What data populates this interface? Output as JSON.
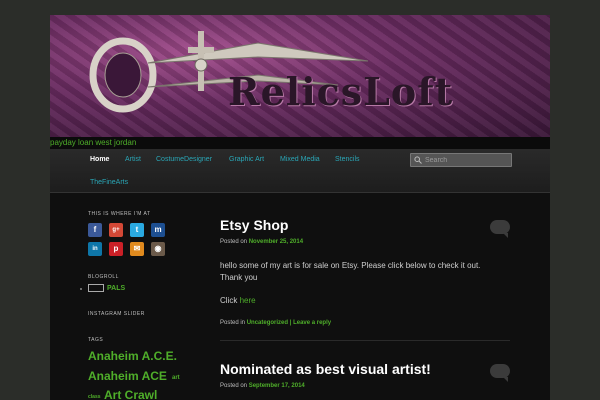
{
  "header": {
    "logo_text": "RelicsLoft",
    "tagline": "payday loan west jordan"
  },
  "nav": {
    "items": [
      {
        "label": "Home",
        "active": true
      },
      {
        "label": "Artist",
        "active": false
      },
      {
        "label": "CostumeDesigner",
        "active": false
      },
      {
        "label": "Graphic Art",
        "active": false
      },
      {
        "label": "Mixed Media",
        "active": false
      },
      {
        "label": "Stencils",
        "active": false
      },
      {
        "label": "TheFineArts",
        "active": false
      }
    ],
    "search_placeholder": "Search"
  },
  "sidebar": {
    "where_title": "This is where I'm at",
    "social_icons": [
      {
        "name": "facebook-icon",
        "glyph": "f",
        "color": "#3b5998"
      },
      {
        "name": "google-plus-icon",
        "glyph": "g+",
        "color": "#d34836"
      },
      {
        "name": "twitter-icon",
        "glyph": "t",
        "color": "#2aa9e0"
      },
      {
        "name": "myspace-icon",
        "glyph": "m",
        "color": "#1d4f91"
      },
      {
        "name": "linkedin-icon",
        "glyph": "in",
        "color": "#0e76a8"
      },
      {
        "name": "pinterest-icon",
        "glyph": "p",
        "color": "#cb2027"
      },
      {
        "name": "rss-icon",
        "glyph": "✉",
        "color": "#e08a1e"
      },
      {
        "name": "instagram-icon",
        "glyph": "◉",
        "color": "#6b5a4a"
      }
    ],
    "blogroll_title": "Blogroll",
    "blogroll_item": "PALS",
    "instagram_title": "Instagram Slider",
    "tags_title": "Tags",
    "tags": [
      "Anaheim A.C.E.",
      "Anaheim ACE",
      "art",
      "class",
      "Art Crawl"
    ]
  },
  "posts": [
    {
      "title": "Etsy Shop",
      "posted_prefix": "Posted on",
      "date": "November 25, 2014",
      "body_line1": "hello some of my art is for sale on Etsy. Please click below to check it out.",
      "body_line2": "Thank you",
      "click_text": "Click",
      "click_link": "here",
      "meta_prefix": "Posted in",
      "category": "Uncategorized",
      "separator": "|",
      "reply": "Leave a reply"
    },
    {
      "title": "Nominated as best visual artist!",
      "posted_prefix": "Posted on",
      "date": "September 17, 2014"
    }
  ],
  "colors": {
    "accent_green": "#4fae2a",
    "nav_link": "#2aa6b6",
    "background": "#0f0f0f"
  }
}
